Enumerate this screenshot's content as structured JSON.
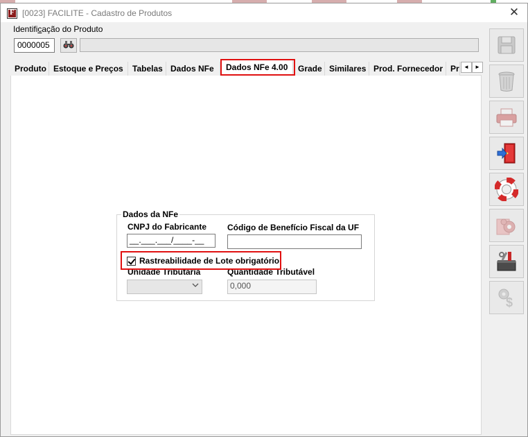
{
  "window": {
    "title": "[0023] FACILITE - Cadastro de Produtos",
    "close_glyph": "✕"
  },
  "product": {
    "id_label_pre": "Identifi",
    "id_label_ul": "c",
    "id_label_post": "ação do Produto",
    "code": "0000005",
    "search_icon": "binoculars-icon"
  },
  "tabs": [
    {
      "label": "Produto",
      "active": false
    },
    {
      "label": "Estoque e Preços",
      "active": false
    },
    {
      "label": "Tabelas",
      "active": false
    },
    {
      "label": "Dados NFe",
      "active": false
    },
    {
      "label": "Dados NFe 4.00",
      "active": true
    },
    {
      "label": "Grade",
      "active": false
    },
    {
      "label": "Similares",
      "active": false
    },
    {
      "label": "Prod. Fornecedor",
      "active": false
    },
    {
      "label": "Pr",
      "active": false
    }
  ],
  "tab_scroll": {
    "left": "◄",
    "right": "►"
  },
  "nfe_group": {
    "title": "Dados da NFe",
    "cnpj_label": "CNPJ do Fabricante",
    "cnpj_value": "__.___.___/____-__",
    "beneficio_label": "Código de Benefício Fiscal da UF",
    "beneficio_value": "",
    "rastreabilidade_label": "Rastreabilidade de Lote obrigatório",
    "rastreabilidade_checked": true,
    "unidade_label": "Unidade Tributária",
    "unidade_value": "",
    "quantidade_label": "Quantidade Tributável",
    "quantidade_value": "0,000"
  },
  "toolbar_buttons": [
    {
      "name": "save-button",
      "icon": "floppy-disk-icon",
      "enabled": false
    },
    {
      "name": "delete-button",
      "icon": "trash-can-icon",
      "enabled": false
    },
    {
      "name": "print-button",
      "icon": "printer-icon",
      "enabled": false
    },
    {
      "name": "exit-button",
      "icon": "exit-door-icon",
      "enabled": true
    },
    {
      "name": "help-button",
      "icon": "lifebuoy-icon",
      "enabled": true
    },
    {
      "name": "settings-button",
      "icon": "gears-icon",
      "enabled": false
    },
    {
      "name": "tools-button",
      "icon": "toolbox-icon",
      "enabled": true
    },
    {
      "name": "pricing-button",
      "icon": "dollar-gear-icon",
      "enabled": false
    }
  ],
  "colors": {
    "highlight": "#e01010",
    "brand": "#8a1c1c"
  }
}
